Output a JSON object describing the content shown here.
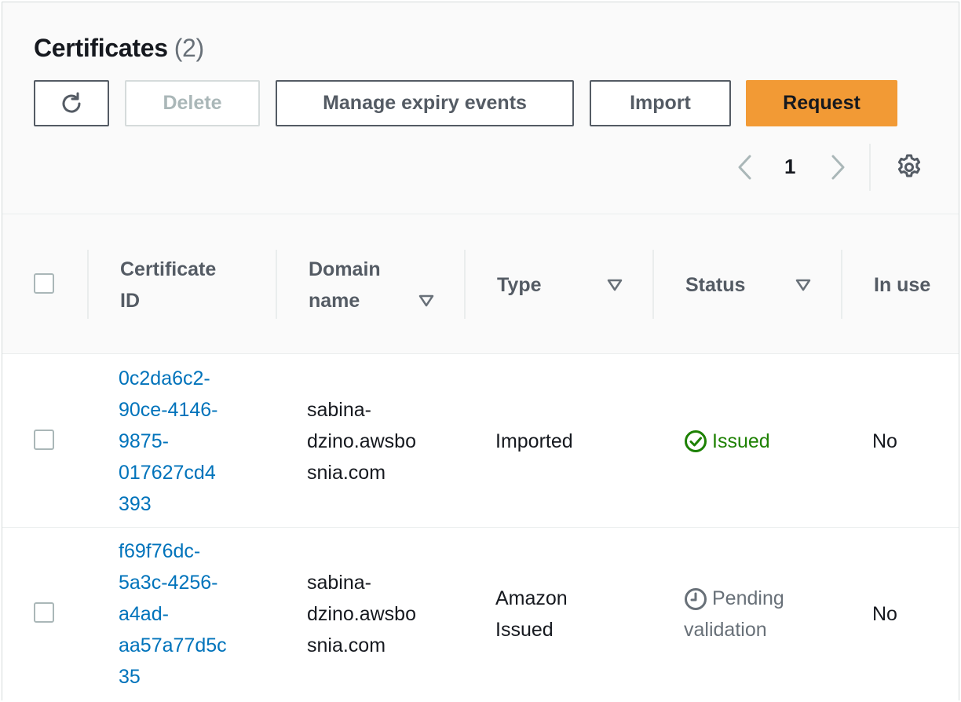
{
  "header": {
    "title": "Certificates",
    "count": "(2)"
  },
  "toolbar": {
    "refresh_icon": "refresh-icon",
    "delete_label": "Delete",
    "manage_label": "Manage expiry events",
    "import_label": "Import",
    "request_label": "Request"
  },
  "pagination": {
    "current_page": "1",
    "prev_icon": "chevron-left-icon",
    "next_icon": "chevron-right-icon",
    "settings_icon": "gear-icon"
  },
  "table": {
    "columns": {
      "certificate_id_l1": "Certificate",
      "certificate_id_l2": "ID",
      "domain_name_l1": "Domain",
      "domain_name_l2": "name",
      "type": "Type",
      "status": "Status",
      "in_use": "In use"
    },
    "rows": [
      {
        "id_lines": [
          "0c2da6c2-",
          "90ce-4146-",
          "9875-",
          "017627cd4",
          "393"
        ],
        "domain_lines": [
          "sabina-",
          "dzino.awsbo",
          "snia.com"
        ],
        "type_lines": [
          "Imported"
        ],
        "status_lines": [
          "Issued"
        ],
        "status_kind": "issued",
        "in_use": "No"
      },
      {
        "id_lines": [
          "f69f76dc-",
          "5a3c-4256-",
          "a4ad-",
          "aa57a77d5c",
          "35"
        ],
        "domain_lines": [
          "sabina-",
          "dzino.awsbo",
          "snia.com"
        ],
        "type_lines": [
          "Amazon",
          "Issued"
        ],
        "status_lines": [
          "Pending",
          "validation"
        ],
        "status_kind": "pending",
        "in_use": "No"
      }
    ]
  },
  "colors": {
    "accent": "#f29a35",
    "link": "#0073bb",
    "success": "#1d8102",
    "muted": "#687078"
  }
}
